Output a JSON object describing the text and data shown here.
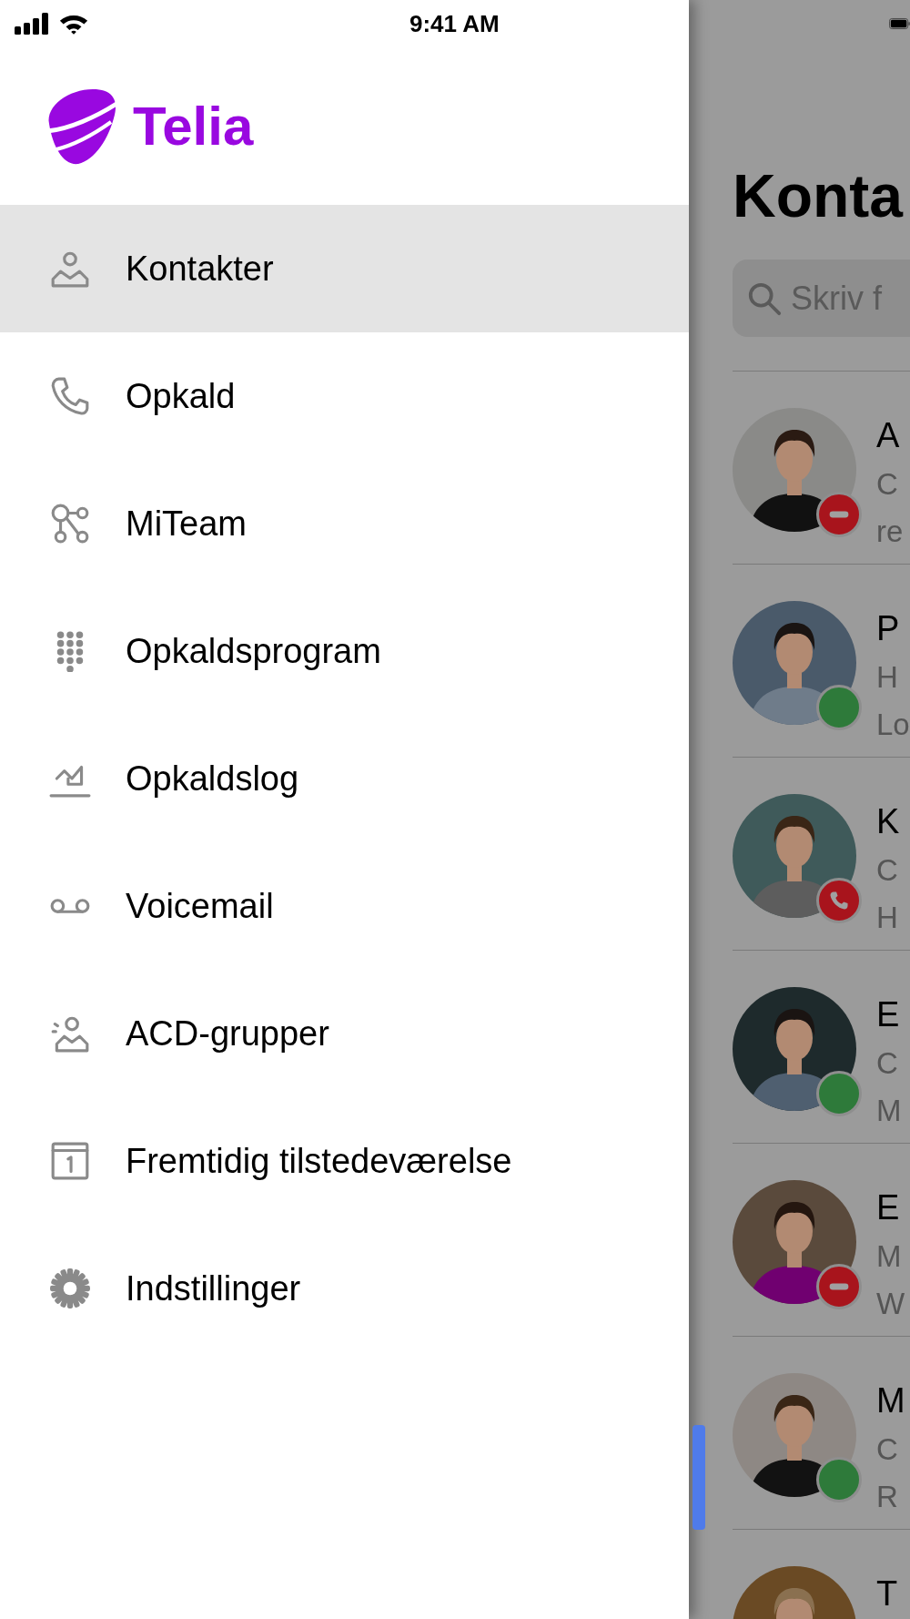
{
  "status_bar": {
    "time": "9:41 AM"
  },
  "drawer": {
    "logo": "Telia",
    "items": [
      {
        "label": "Kontakter",
        "selected": true
      },
      {
        "label": "Opkald",
        "selected": false
      },
      {
        "label": "MiTeam",
        "selected": false
      },
      {
        "label": "Opkaldsprogram",
        "selected": false
      },
      {
        "label": "Opkaldslog",
        "selected": false
      },
      {
        "label": "Voicemail",
        "selected": false
      },
      {
        "label": "ACD-grupper",
        "selected": false
      },
      {
        "label": "Fremtidig tilstedeværelse",
        "selected": false
      },
      {
        "label": "Indstillinger",
        "selected": false
      }
    ]
  },
  "contacts_panel": {
    "title": "Konta",
    "search": {
      "placeholder": "Skriv f"
    },
    "contacts": [
      {
        "name": "A",
        "lines": [
          "C",
          "re"
        ],
        "kind": "dnd"
      },
      {
        "name": "P",
        "lines": [
          "H",
          "Lo"
        ],
        "kind": "available"
      },
      {
        "name": "K",
        "lines": [
          "C",
          "H"
        ],
        "kind": "in-call"
      },
      {
        "name": "E",
        "lines": [
          "C",
          "M"
        ],
        "kind": "available"
      },
      {
        "name": "E",
        "lines": [
          "M",
          "W"
        ],
        "kind": "dnd"
      },
      {
        "name": "M",
        "lines": [
          "C",
          "R"
        ],
        "kind": "available"
      },
      {
        "name": "T",
        "kind": "none"
      }
    ]
  }
}
